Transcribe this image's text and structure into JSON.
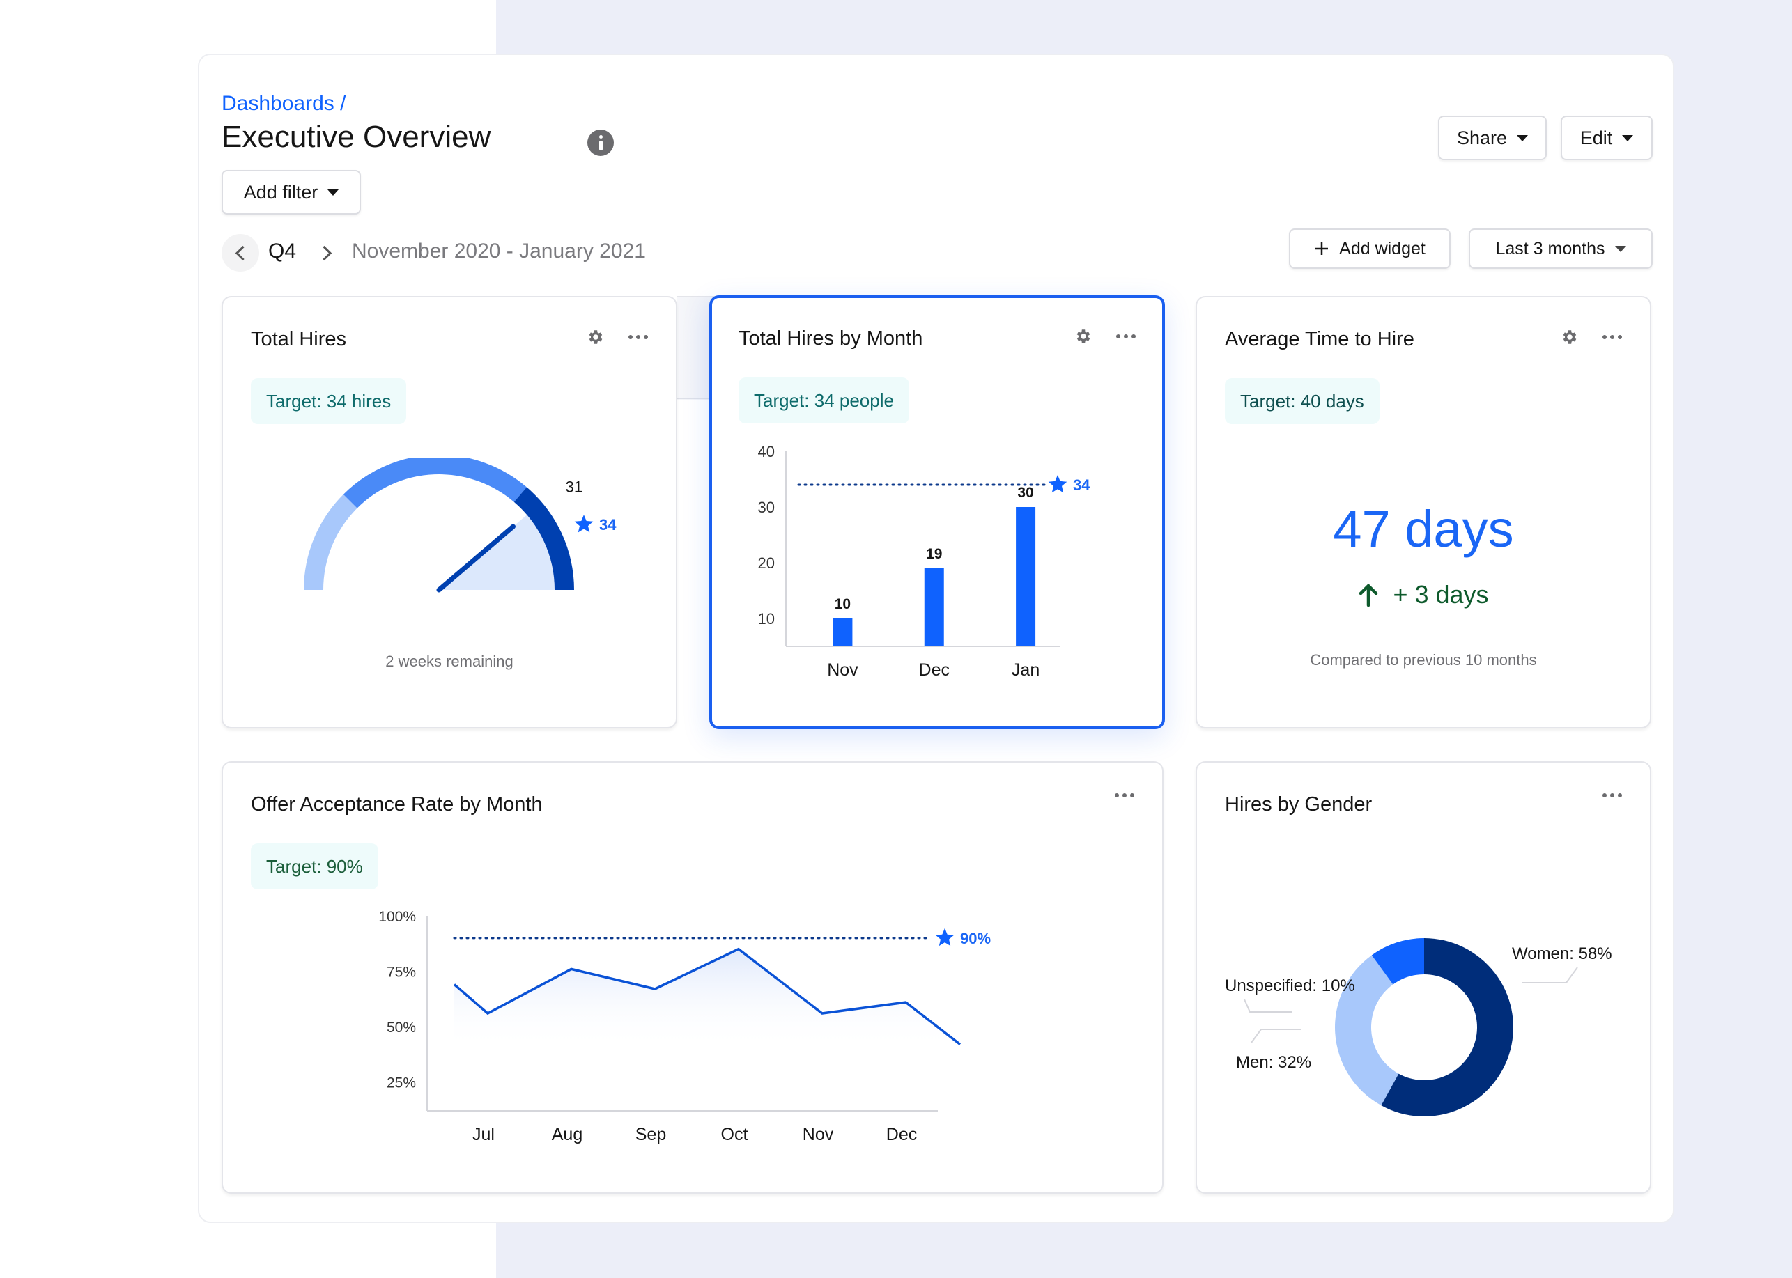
{
  "header": {
    "breadcrumb": "Dashboards /",
    "title": "Executive Overview",
    "info_icon": "info-icon",
    "add_filter_label": "Add filter",
    "share_label": "Share",
    "edit_label": "Edit"
  },
  "period": {
    "quarter": "Q4",
    "date_range": "November 2020 - January 2021",
    "add_widget_label": "Add widget",
    "range_select": "Last 3 months"
  },
  "colors": {
    "accent": "#0F62FE",
    "selected_border": "#1A5FF0",
    "badge_bg": "#EEFBFB",
    "page_bg_right": "#ECEEF8",
    "navy": "#002D7A",
    "light_blue": "#A8C8FB",
    "mid_blue": "#4A8AF7",
    "dark_blue": "#0040B0",
    "positive": "#0E5A2C"
  },
  "widgets": {
    "total_hires": {
      "title": "Total Hires",
      "target": "Target: 34 hires",
      "value": 31,
      "value_label": "31",
      "target_value": 34,
      "target_label": "34",
      "gauge_max": 40,
      "footer": "2 weeks remaining"
    },
    "hires_by_month": {
      "title": "Total Hires by Month",
      "target": "Target: 34 people"
    },
    "avg_time": {
      "title": "Average Time to Hire",
      "target": "Target: 40 days",
      "value": "47 days",
      "delta": "+ 3 days",
      "footer": "Compared to previous 10 months"
    },
    "offer_rate": {
      "title": "Offer Acceptance Rate by Month",
      "target": "Target: 90%"
    },
    "gender": {
      "title": "Hires by Gender"
    }
  },
  "chart_data": [
    {
      "type": "gauge",
      "title": "Total Hires",
      "value": 31,
      "target": 34,
      "range": [
        0,
        40
      ],
      "segments": [
        {
          "from": 0,
          "to": 10
        },
        {
          "from": 10,
          "to": 29
        },
        {
          "from": 29,
          "to": 40
        }
      ]
    },
    {
      "type": "bar",
      "title": "Total Hires by Month",
      "categories": [
        "Nov",
        "Dec",
        "Jan"
      ],
      "values": [
        10,
        19,
        30
      ],
      "ylim": [
        5,
        40
      ],
      "yticks": [
        10,
        20,
        30,
        40
      ],
      "target": 34,
      "target_label": "34",
      "xlabel": "",
      "ylabel": ""
    },
    {
      "type": "area",
      "title": "Offer Acceptance Rate by Month",
      "categories": [
        "Jul",
        "Aug",
        "Sep",
        "Oct",
        "Nov",
        "Dec"
      ],
      "series": [
        {
          "name": "Offer acceptance rate",
          "values": [
            69,
            56,
            76,
            67,
            85,
            56,
            61,
            42
          ]
        }
      ],
      "x_points": [
        -0.4,
        0,
        1,
        2,
        3,
        4,
        5,
        5.65
      ],
      "ylim": [
        12,
        100
      ],
      "yticks": [
        25,
        50,
        75,
        100
      ],
      "ytick_labels": [
        "25%",
        "50%",
        "75%",
        "100%"
      ],
      "target": 90,
      "target_label": "90%",
      "xlabel": "",
      "ylabel": ""
    },
    {
      "type": "pie",
      "title": "Hires by Gender",
      "donut": true,
      "slices": [
        {
          "label": "Women",
          "value": 58,
          "text": "Women: 58%"
        },
        {
          "label": "Men",
          "value": 32,
          "text": "Men: 32%"
        },
        {
          "label": "Unspecified",
          "value": 10,
          "text": "Unspecified: 10%"
        }
      ]
    }
  ]
}
